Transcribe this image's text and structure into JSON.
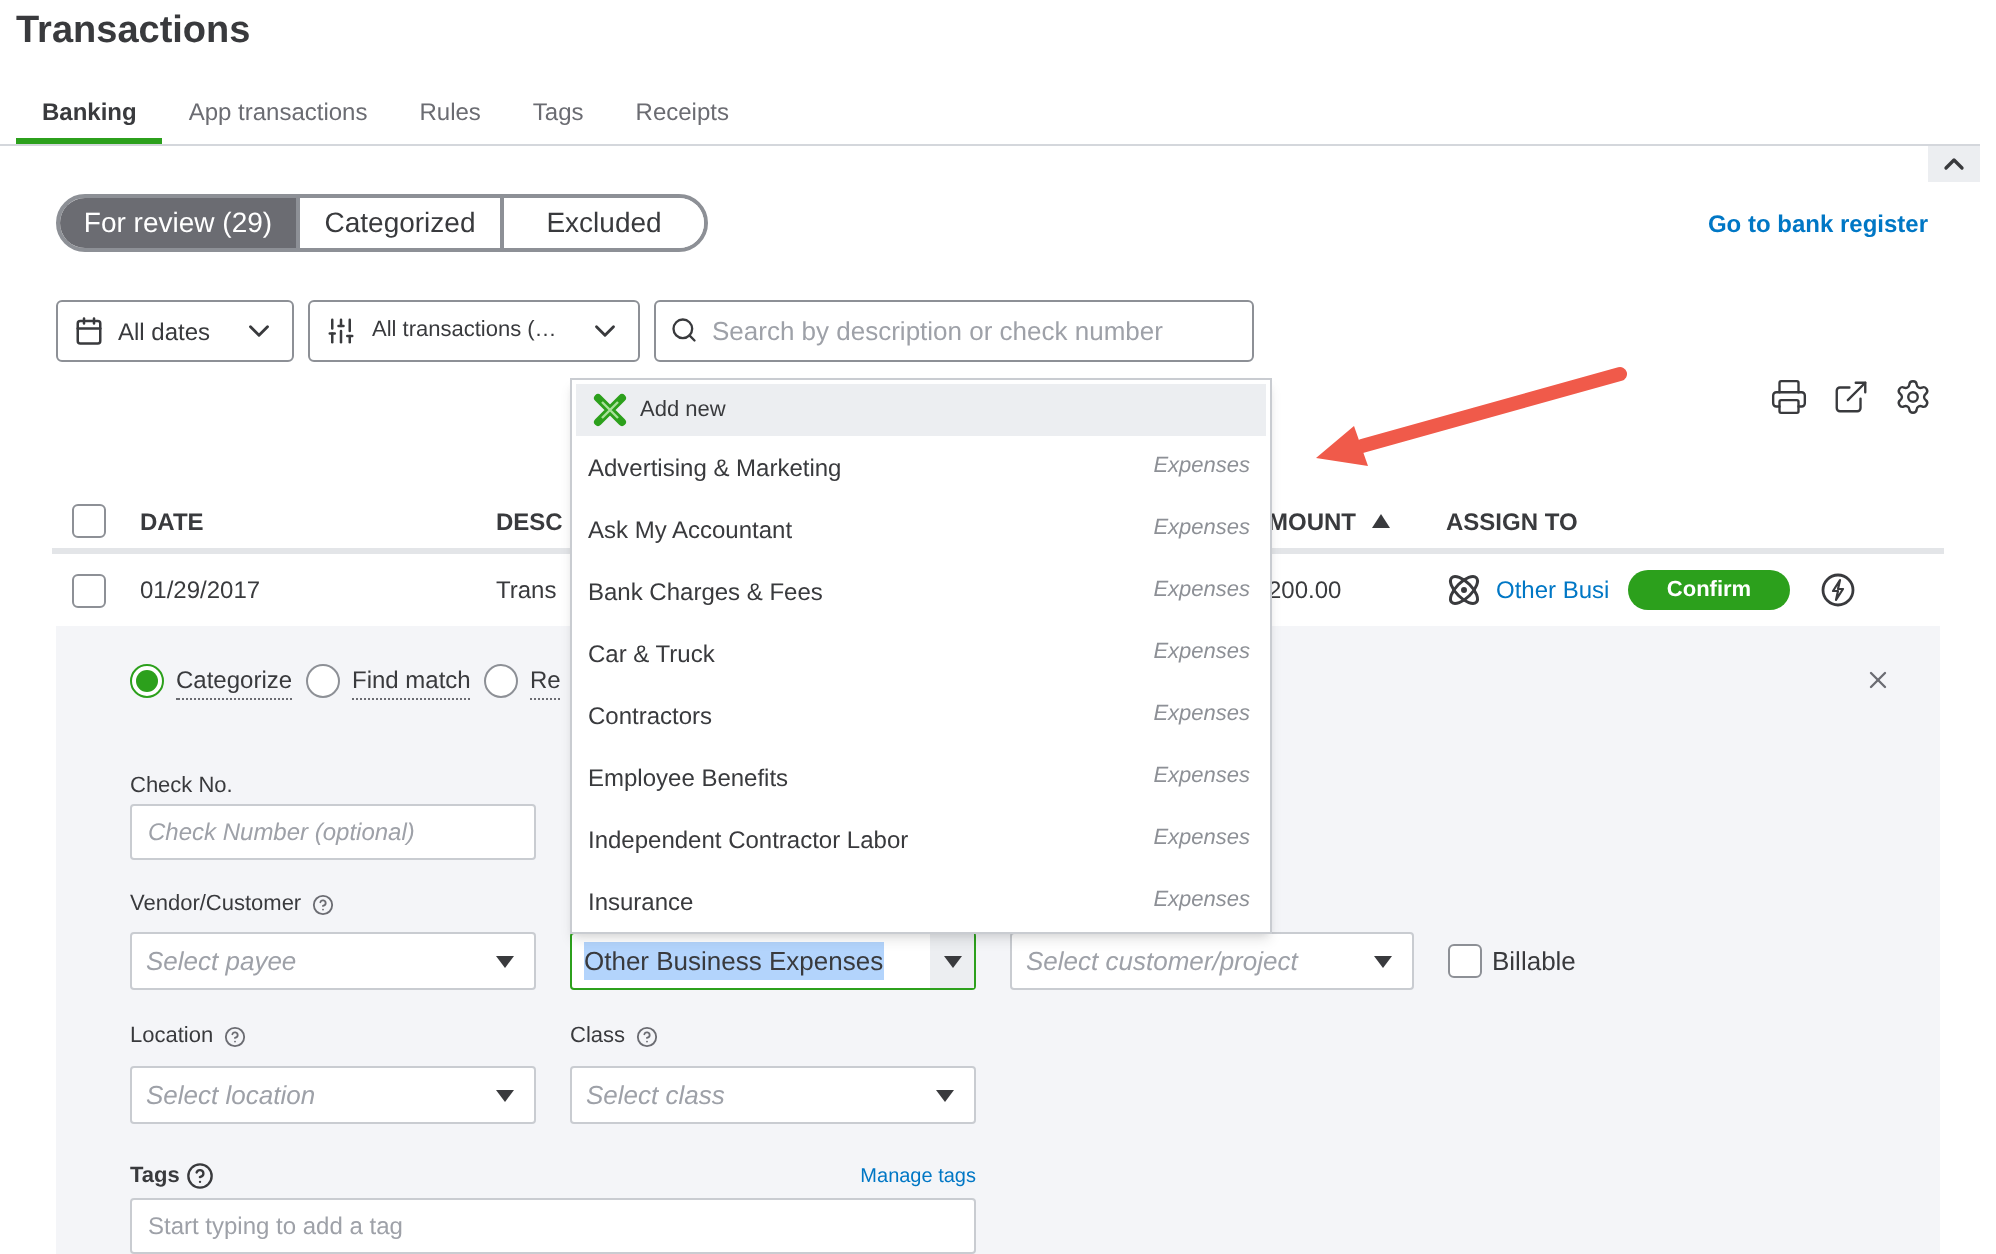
{
  "page": {
    "title": "Transactions"
  },
  "tabs": [
    {
      "label": "Banking",
      "selected": true
    },
    {
      "label": "App transactions",
      "selected": false
    },
    {
      "label": "Rules",
      "selected": false
    },
    {
      "label": "Tags",
      "selected": false
    },
    {
      "label": "Receipts",
      "selected": false
    }
  ],
  "review_tabs": [
    {
      "label": "For review (29)",
      "selected": true
    },
    {
      "label": "Categorized",
      "selected": false
    },
    {
      "label": "Excluded",
      "selected": false
    }
  ],
  "bank_register_link": "Go to bank register",
  "filters": {
    "dates": "All dates",
    "transactions": "All transactions (…",
    "search_placeholder": "Search by description or check number"
  },
  "table": {
    "header_checked": false,
    "columns": [
      "DATE",
      "DESC",
      "MOUNT",
      "ASSIGN TO"
    ],
    "rows": [
      {
        "checked": false,
        "date": "01/29/2017",
        "description": "Trans",
        "amount": "200.00",
        "assign_to": "Other Busi",
        "action": "Confirm"
      }
    ]
  },
  "detail": {
    "modes": [
      {
        "label": "Categorize",
        "selected": true
      },
      {
        "label": "Find match",
        "selected": false
      },
      {
        "label": "Re",
        "selected": false
      }
    ],
    "check_no": {
      "label": "Check No.",
      "placeholder": "Check Number (optional)"
    },
    "vendor": {
      "label": "Vendor/Customer",
      "placeholder": "Select payee"
    },
    "category": {
      "value": "Other Business Expenses"
    },
    "customer": {
      "placeholder": "Select customer/project"
    },
    "billable": {
      "label": "Billable",
      "checked": false
    },
    "location": {
      "label": "Location",
      "placeholder": "Select location"
    },
    "class": {
      "label": "Class",
      "placeholder": "Select class"
    },
    "tags": {
      "label": "Tags",
      "manage_link": "Manage tags",
      "placeholder": "Start typing to add a tag"
    }
  },
  "dropdown": {
    "add_new": "Add new",
    "items": [
      {
        "name": "Advertising & Marketing",
        "type": "Expenses"
      },
      {
        "name": "Ask My Accountant",
        "type": "Expenses"
      },
      {
        "name": "Bank Charges & Fees",
        "type": "Expenses"
      },
      {
        "name": "Car & Truck",
        "type": "Expenses"
      },
      {
        "name": "Contractors",
        "type": "Expenses"
      },
      {
        "name": "Employee Benefits",
        "type": "Expenses"
      },
      {
        "name": "Independent Contractor Labor",
        "type": "Expenses"
      },
      {
        "name": "Insurance",
        "type": "Expenses"
      }
    ]
  }
}
